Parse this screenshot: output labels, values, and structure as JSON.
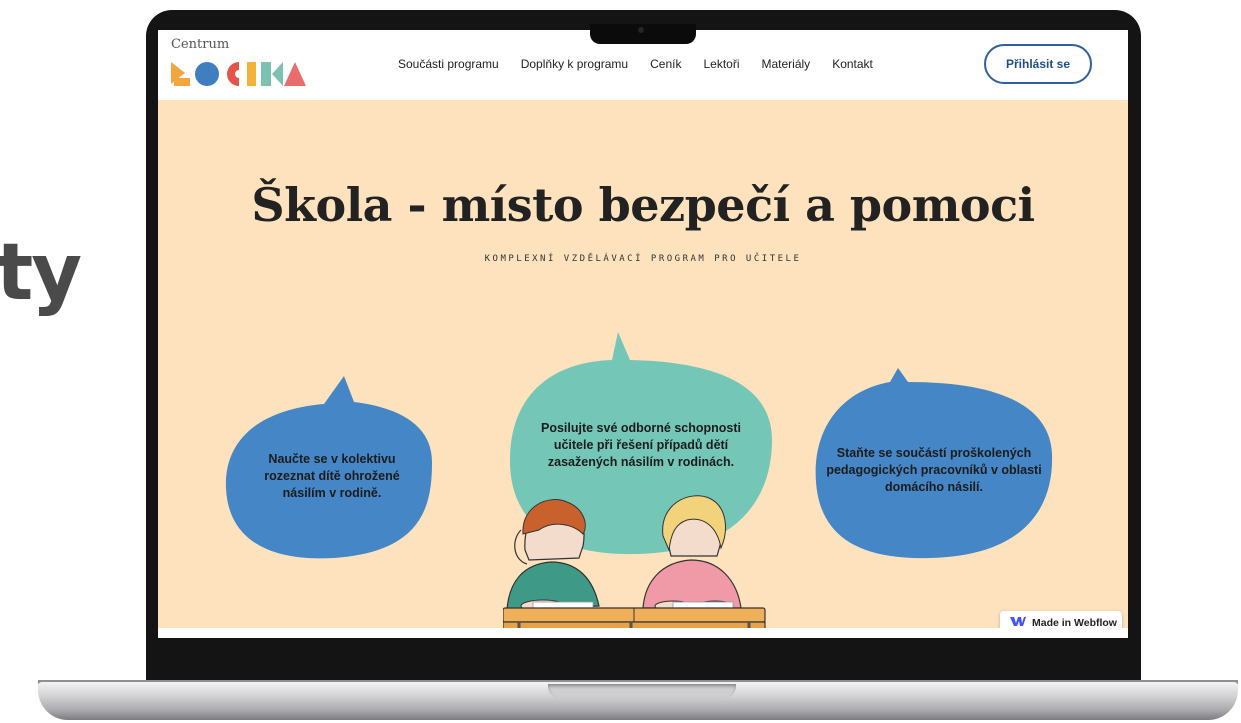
{
  "background_text": "ty",
  "logo": {
    "small_text": "Centrum",
    "word": "LOGIKA"
  },
  "nav": {
    "links": [
      "Součásti programu",
      "Doplňky k programu",
      "Ceník",
      "Lektoři",
      "Materiály",
      "Kontakt"
    ],
    "login_label": "Přihlásit se"
  },
  "hero": {
    "title": "Škola - místo bezpečí a pomoci",
    "subtitle": "KOMPLEXNÍ VZDĚLÁVACÍ PROGRAM PRO UČITELE"
  },
  "bubbles": [
    {
      "text": "Naučte se v kolektivu rozeznat dítě ohrožené násilím v rodině.",
      "color": "#4486c6"
    },
    {
      "text": "Posilujte své odborné schopnosti učitele při řešení případů dětí zasažených násilím v rodinách.",
      "color": "#74c7b7"
    },
    {
      "text": "Staňte se součástí proškolených pedagogických pracovníků v oblasti domácího násilí.",
      "color": "#4486c6"
    }
  ],
  "badge": {
    "label": "Made in Webflow",
    "icon": "webflow-icon"
  },
  "colors": {
    "screen_bg": "#fde2bd",
    "accent_blue": "#4486c6",
    "accent_teal": "#74c7b7",
    "button_border": "#2f5f9c"
  }
}
